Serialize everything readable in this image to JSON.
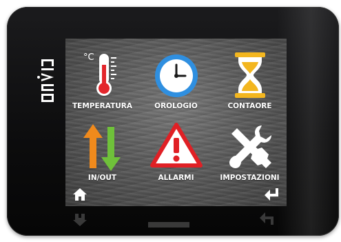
{
  "brand": {
    "logo_text": "EVCO"
  },
  "menu": [
    {
      "label": "TEMPERATURA",
      "icon": "thermometer-icon",
      "unit": "°C"
    },
    {
      "label": "OROLOGIO",
      "icon": "clock-icon"
    },
    {
      "label": "CONTAORE",
      "icon": "hourglass-icon"
    },
    {
      "label": "IN/OUT",
      "icon": "in-out-arrows-icon"
    },
    {
      "label": "ALLARMI",
      "icon": "warning-triangle-icon"
    },
    {
      "label": "IMPOSTAZIONI",
      "icon": "tools-icon"
    }
  ],
  "nav": {
    "home_icon": "home-icon",
    "enter_icon": "enter-return-icon"
  },
  "colors": {
    "thermometer_red": "#e3262c",
    "clock_blue": "#2f8fe0",
    "hourglass_gold": "#f3b61f",
    "arrow_orange": "#f08a1c",
    "arrow_green": "#6fc13a",
    "alarm_red": "#e02025"
  }
}
